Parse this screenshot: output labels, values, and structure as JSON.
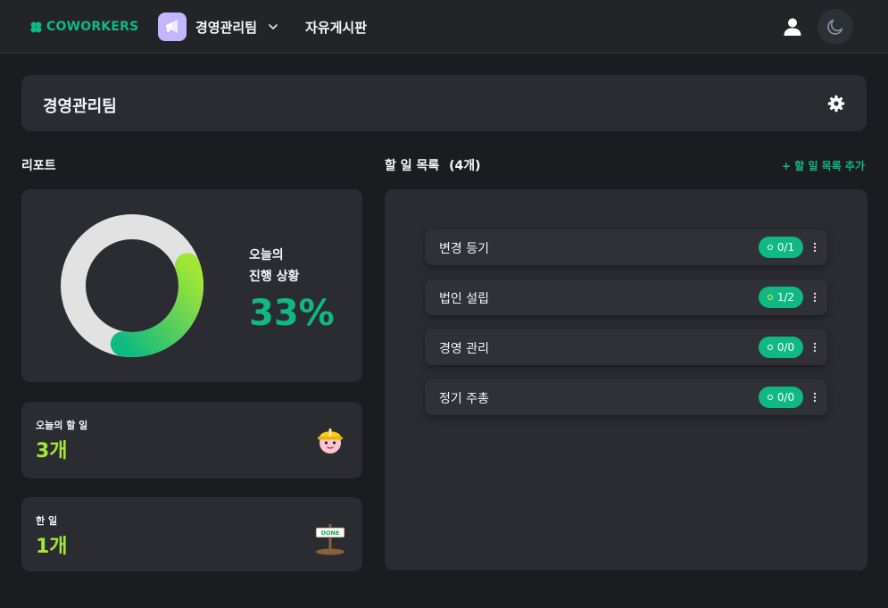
{
  "topbar": {
    "logo_text": "COWORKERS",
    "team_name": "경영관리팀",
    "board_link": "자유게시판"
  },
  "team_header": {
    "title": "경영관리팀"
  },
  "report": {
    "section_title": "리포트",
    "progress": {
      "label_line1": "오늘의",
      "label_line2": "진행 상황",
      "percent_text": "33%",
      "fraction": 0.33
    },
    "today_todo": {
      "label": "오늘의 할 일",
      "value": "3개"
    },
    "done": {
      "label": "한 일",
      "value": "1개",
      "sign_text": "DONE"
    }
  },
  "todo_lists": {
    "title": "할 일 목록",
    "count": "(4개)",
    "add_label": "+ 할 일 목록 추가",
    "items": [
      {
        "name": "변경 등기",
        "status": "0/1",
        "in_progress": false
      },
      {
        "name": "법인 설립",
        "status": "1/2",
        "in_progress": true
      },
      {
        "name": "경영 관리",
        "status": "0/0",
        "in_progress": false
      },
      {
        "name": "정기 주총",
        "status": "0/0",
        "in_progress": false
      }
    ]
  },
  "colors": {
    "accent": "#10b981",
    "accent_lime": "#a3e635",
    "card": "#2b2c31",
    "background": "#1b1c20",
    "donut_track": "#e2e2e2"
  }
}
